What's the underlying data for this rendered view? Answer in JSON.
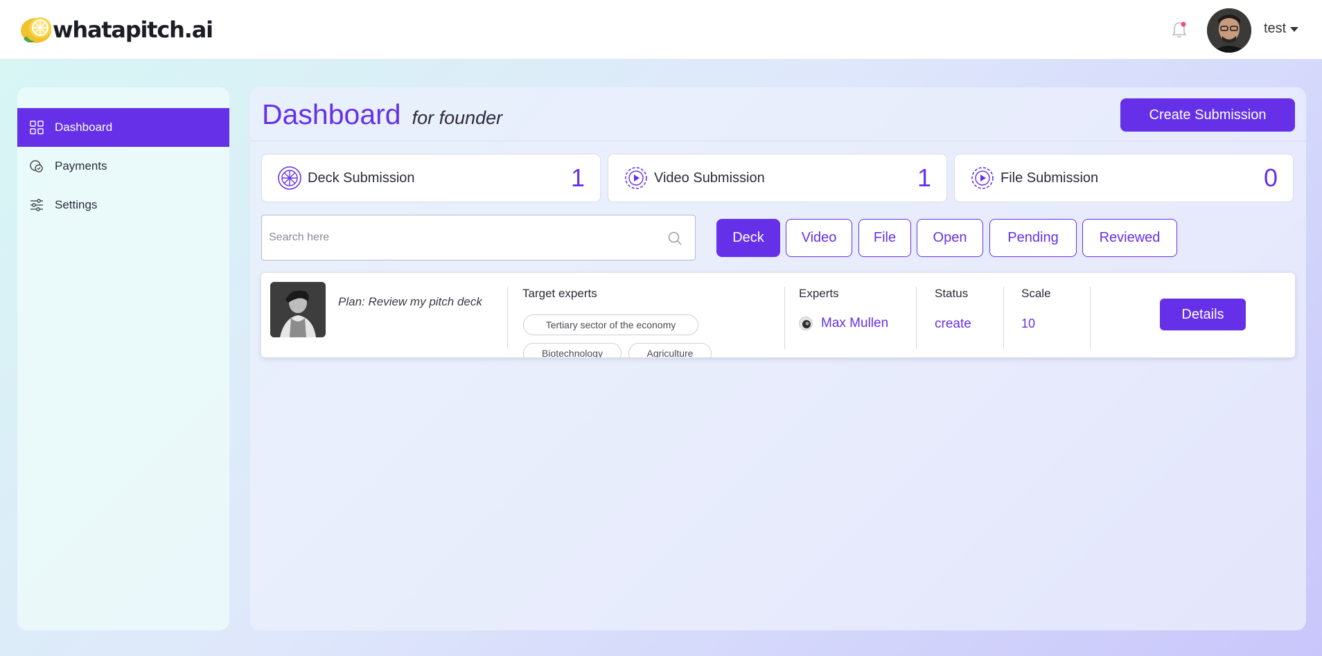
{
  "header": {
    "brand": "whatapitch.ai",
    "user_name": "test"
  },
  "sidebar": {
    "items": [
      {
        "label": "Dashboard",
        "icon": "grid-icon",
        "active": true
      },
      {
        "label": "Payments",
        "icon": "payments-icon",
        "active": false
      },
      {
        "label": "Settings",
        "icon": "sliders-icon",
        "active": false
      }
    ]
  },
  "main": {
    "title": "Dashboard",
    "subtitle": "for founder",
    "create_label": "Create Submission",
    "stats": [
      {
        "label": "Deck Submission",
        "value": "1",
        "icon": "deck-icon"
      },
      {
        "label": "Video Submission",
        "value": "1",
        "icon": "video-gear-icon"
      },
      {
        "label": "File Submission",
        "value": "0",
        "icon": "file-gear-icon"
      }
    ],
    "search": {
      "placeholder": "Search here",
      "value": ""
    },
    "filters": [
      {
        "label": "Deck",
        "active": true
      },
      {
        "label": "Video",
        "active": false
      },
      {
        "label": "File",
        "active": false
      },
      {
        "label": "Open",
        "active": false
      },
      {
        "label": "Pending",
        "active": false
      },
      {
        "label": "Reviewed",
        "active": false
      }
    ],
    "submission": {
      "plan": "Plan: Review my pitch deck",
      "target_experts_label": "Target experts",
      "tags": [
        "Tertiary sector of the economy",
        "Biotechnology",
        "Agriculture"
      ],
      "experts_label": "Experts",
      "expert_name": "Max Mullen",
      "status_label": "Status",
      "status_value": "create",
      "scale_label": "Scale",
      "scale_value": "10",
      "details_label": "Details"
    }
  },
  "colors": {
    "accent": "#6530e8",
    "bg_gradient_start": "#d6f7f3",
    "bg_gradient_end": "#c9c6fb",
    "notification_dot": "#f0506e"
  }
}
